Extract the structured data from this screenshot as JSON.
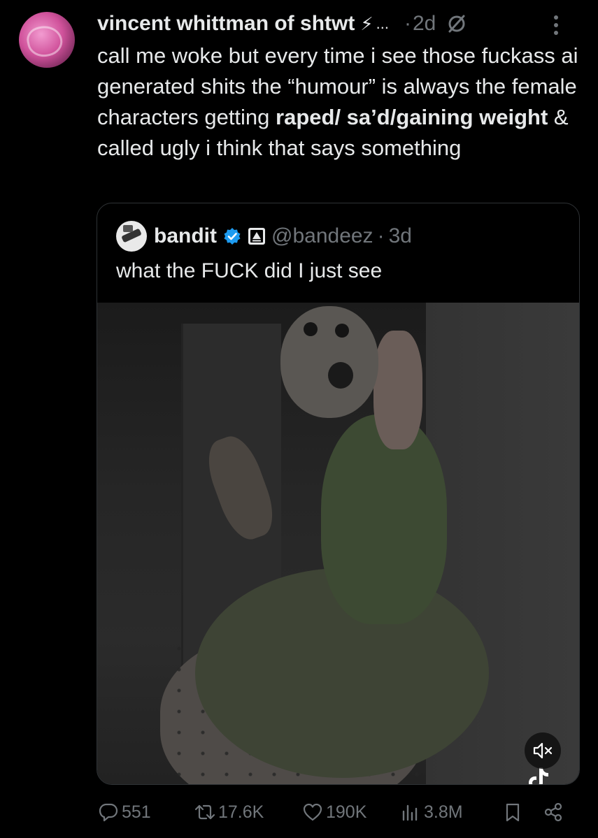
{
  "post": {
    "author_name": "vincent whittman of shtwt",
    "bolt": "⚡",
    "ellipsis": "...",
    "separator": "·",
    "timestamp": "2d",
    "text_parts": [
      "call me woke but every time i see those fuckass ai generated shits the “humour” is always the female characters getting ",
      "raped/ sa’d/gaining weight",
      " & called ugly i think that says something"
    ]
  },
  "quoted": {
    "name": "bandit",
    "handle": "@bandeez",
    "separator": "·",
    "timestamp": "3d",
    "text": "what the FUCK did I just see"
  },
  "actions": {
    "replies": "551",
    "reposts": "17.6K",
    "likes": "190K",
    "views": "3.8M"
  },
  "colors": {
    "background": "#000000",
    "text": "#e7e9ea",
    "muted": "#71767b",
    "verified": "#1d9bf0",
    "border": "#2f3336"
  },
  "icons": [
    "more-icon",
    "emptyset-icon",
    "verified-icon",
    "affiliate-icon",
    "mute-icon",
    "tiktok-icon",
    "reply-icon",
    "repost-icon",
    "like-icon",
    "views-icon",
    "bookmark-icon",
    "share-icon"
  ]
}
